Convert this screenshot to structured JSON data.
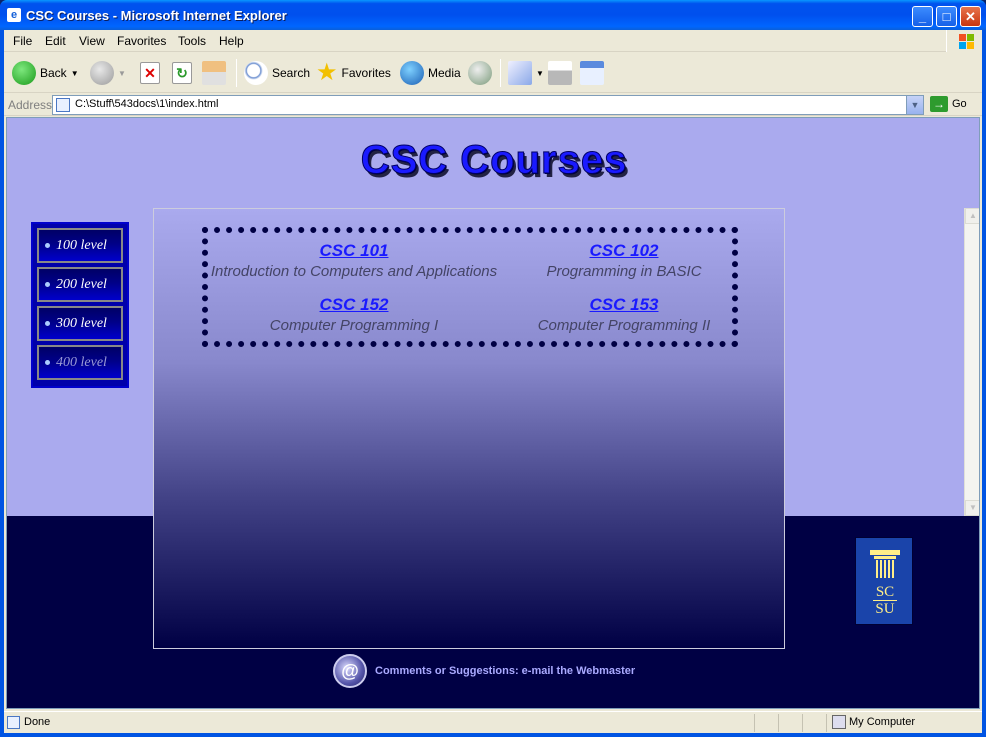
{
  "window": {
    "title": "CSC Courses - Microsoft Internet Explorer",
    "icon_glyph": "e"
  },
  "menu": [
    "File",
    "Edit",
    "View",
    "Favorites",
    "Tools",
    "Help"
  ],
  "toolbar": {
    "back_label": "Back",
    "search_label": "Search",
    "favorites_label": "Favorites",
    "media_label": "Media"
  },
  "address": {
    "label": "Address",
    "url": "C:\\Stuff\\543docs\\1\\index.html",
    "go_label": "Go"
  },
  "page": {
    "heading": "CSC Courses",
    "levels": [
      "100 level",
      "200 level",
      "300 level",
      "400 level"
    ],
    "courses": [
      {
        "code": "CSC 101",
        "title": "Introduction to Computers and Applications"
      },
      {
        "code": "CSC 102",
        "title": "Programming in BASIC"
      },
      {
        "code": "CSC 152",
        "title": "Computer Programming I"
      },
      {
        "code": "CSC 153",
        "title": "Computer Programming II"
      }
    ],
    "logo_lines": [
      "SC",
      "SU"
    ],
    "footer_icon": "@",
    "footer_text": "Comments or Suggestions: e-mail the Webmaster"
  },
  "status": {
    "text": "Done",
    "zone": "My Computer"
  },
  "colors": {
    "heading": "#1a1aff",
    "page_bg_top": "#aaaaee",
    "page_bg_bottom": "#000044",
    "link": "#1a1aff",
    "footer_text": "#aaaaff"
  }
}
